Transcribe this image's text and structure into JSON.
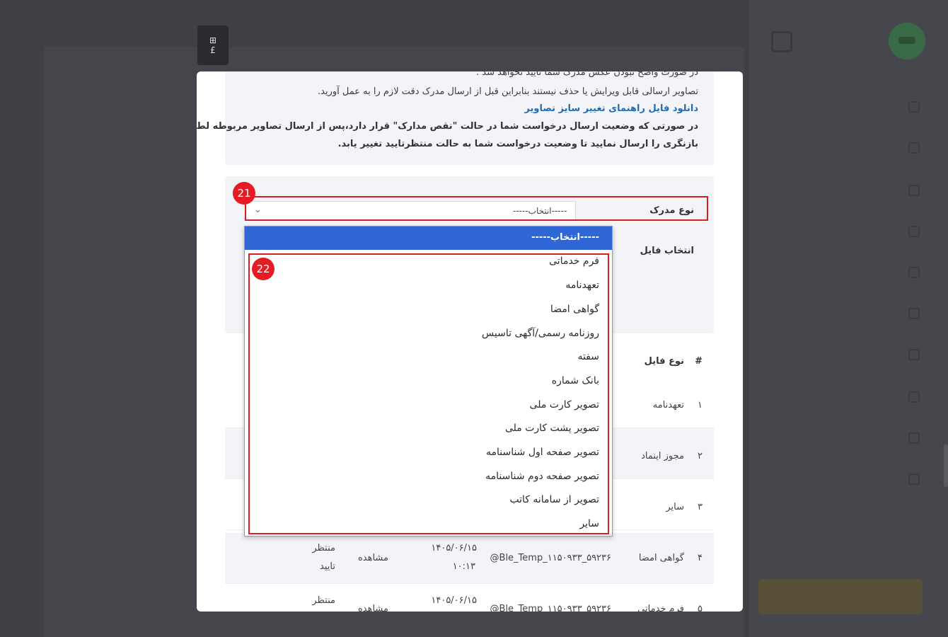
{
  "page": {
    "background_color": "#3f4044",
    "modal_color": "#ffffff",
    "accent_selected": "#2f67d6",
    "annotation_color": "#e51c23"
  },
  "floating_tool": {
    "icon": "inbox-tray-icon",
    "glyph": "⊞\n£"
  },
  "info": {
    "line0": "در صورت واضح نبودن عکس مدرک شما تایید نخواهد شد .",
    "line1": "تصاویر ارسالی قابل ویرایش یا حذف نیستند بنابراین قبل از ارسال مدرک دقت لازم را به عمل آورید.",
    "download_link": "دانلود فایل راهنمای تغییر سایز تصاویر",
    "line3": "در صورتی که وضعیت ارسال درخواست شما در حالت \"نقص مدارک\" قرار دارد،پس از ارسال تصاویر مربوطه لطفا درخواست",
    "line4": "بازنگری را ارسال نمایید تا وضعیت درخواست شما به حالت منتظرتایید تغییر یابد."
  },
  "form": {
    "doc_type_label": "نوع مدرک",
    "doc_type_value": "-----انتخاب-----",
    "file_label": "انتخاب فایل",
    "chevron_icon": "chevron-down-icon"
  },
  "annotations": {
    "badge_21": "21",
    "badge_22": "22"
  },
  "dropdown": {
    "selected": "-----انتخاب-----",
    "options": [
      "فرم خدماتی",
      "تعهدنامه",
      "گواهی امضا",
      "روزنامه رسمی/آگهی تاسیس",
      "سفته",
      "بانک شماره",
      "تصویر کارت ملی",
      "تصویر پشت کارت ملی",
      "تصویر صفحه اول شناسنامه",
      "تصویر صفحه دوم شناسنامه",
      "تصویر از سامانه کاتب",
      "سایر"
    ]
  },
  "table": {
    "headers": {
      "index": "#",
      "file_type": "نوع فایل"
    },
    "rows": [
      {
        "index": "۱",
        "file_type": "تعهدنامه"
      },
      {
        "index": "۲",
        "file_type": "مجوز اینماد"
      },
      {
        "index": "۳",
        "file_type": "سایر"
      },
      {
        "index": "۴",
        "file_type": "گواهی امضا",
        "file_name": "Ble_Temp_۱۱۵۰۹۳۳_۵۹۲۳۶@",
        "date": "۱۴۰۵/۰۶/۱۵",
        "time": "۱۰:۱۳",
        "action": "مشاهده",
        "status_line1": "منتظر",
        "status_line2": "تایید"
      },
      {
        "index": "۵",
        "file_type": "فرم خدماتی",
        "file_name": "Ble_Temp_۱۱۵۰۹۳۳_۵۹۲۳۶@",
        "date": "۱۴۰۵/۰۶/۱۵",
        "action": "مشاهده",
        "status_line1": "منتظر"
      }
    ]
  }
}
